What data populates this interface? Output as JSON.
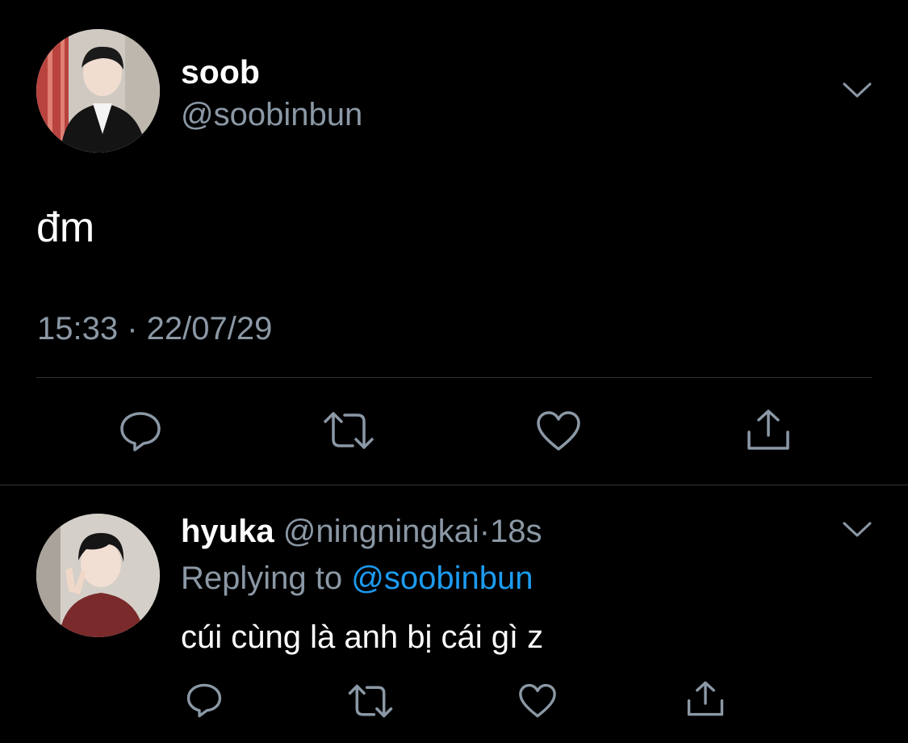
{
  "main_tweet": {
    "display_name": "soob",
    "handle": "@soobinbun",
    "text": "đm",
    "timestamp": "15:33 · 22/07/29",
    "avatar_icon": "profile-photo",
    "menu_icon": "chevron-down-icon",
    "actions": [
      "reply-icon",
      "retweet-icon",
      "like-icon",
      "share-icon"
    ]
  },
  "reply_tweet": {
    "display_name": "hyuka",
    "handle": "@ningningkai",
    "separator": "·",
    "time_ago": "18s",
    "replying_prefix": "Replying to",
    "replying_to": "@soobinbun",
    "text": "cúi cùng là anh bị cái gì z",
    "avatar_icon": "profile-photo",
    "menu_icon": "chevron-down-icon",
    "actions": [
      "reply-icon",
      "retweet-icon",
      "like-icon",
      "share-icon"
    ]
  },
  "colors": {
    "background": "#000000",
    "primary_text": "#ffffff",
    "secondary_text": "#8b98a5",
    "link": "#1d9bf0",
    "divider": "#2f3336",
    "icon": "#8b98a5"
  }
}
